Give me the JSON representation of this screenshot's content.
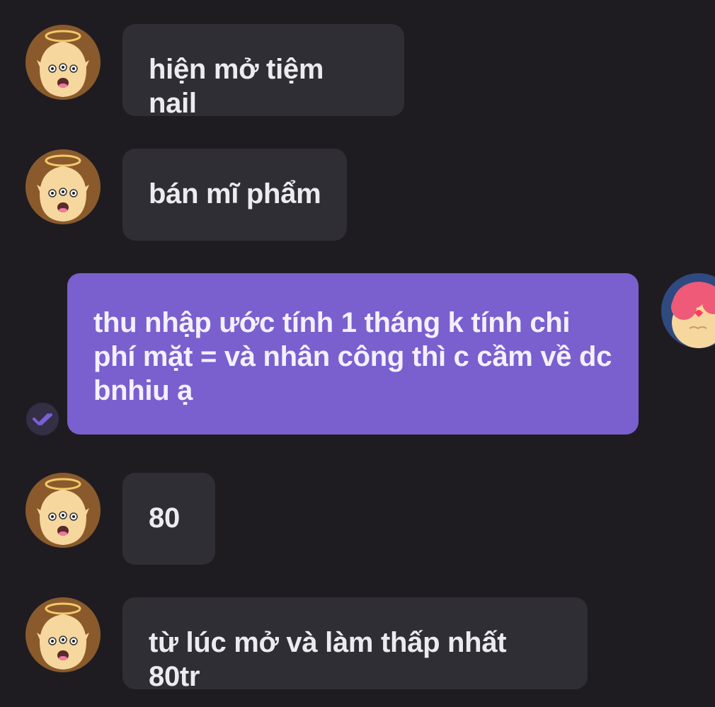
{
  "colors": {
    "background": "#1e1c21",
    "incoming_bubble": "#302e35",
    "outgoing_bubble": "#7a5fcf",
    "text": "#ececf0",
    "seen_icon": "#7b5fd6"
  },
  "messages": [
    {
      "side": "incoming",
      "avatar_icon": "angel-face-icon",
      "text": "hiện mở tiệm nail"
    },
    {
      "side": "incoming",
      "avatar_icon": "angel-face-icon",
      "text": "bán mĩ phẩm"
    },
    {
      "side": "outgoing",
      "avatar_icon": "pink-hair-face-icon",
      "status_icon": "double-check-icon",
      "text": "thu nhập ước tính 1 tháng k tính chi phí mặt = và nhân công thì c cầm về dc bnhiu ạ"
    },
    {
      "side": "incoming",
      "avatar_icon": "angel-face-icon",
      "text": "80"
    },
    {
      "side": "incoming",
      "avatar_icon": "angel-face-icon",
      "text": "từ lúc mở và làm thấp nhất 80tr"
    }
  ]
}
